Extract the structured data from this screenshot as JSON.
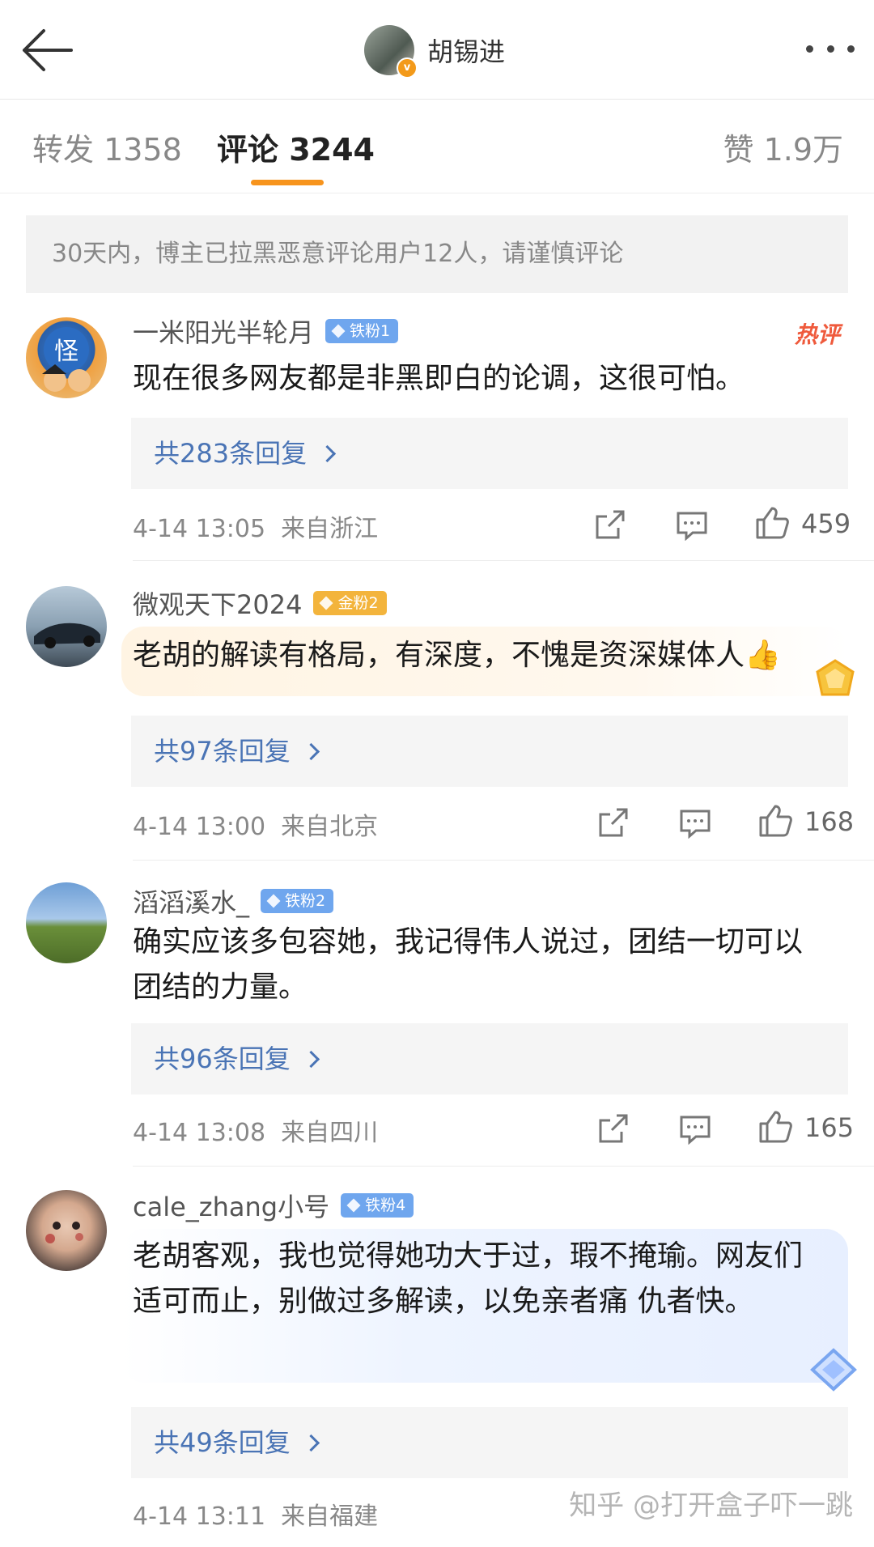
{
  "header": {
    "back_icon": "arrow-left-icon",
    "username": "胡锡进",
    "verified_icon": "verified-v-icon",
    "more_icon": "more-dots-icon"
  },
  "tabs": [
    {
      "label": "转发 1358"
    },
    {
      "label": "评论 3244"
    },
    {
      "label": "赞 1.9万"
    }
  ],
  "active_tab_color": "#f7941d",
  "notice": "30天内，博主已拉黑恶意评论用户12人，请谨慎评论",
  "comments": [
    {
      "name": "一米阳光半轮月",
      "badge": "铁粉1",
      "text": "现在很多网友都是非黑即白的论调，这很可怕。",
      "hot_tag": "热评",
      "replies": "共283条回复",
      "time": "4-14 13:05",
      "location": "来自浙江",
      "likes": "459"
    },
    {
      "name": "微观天下2024",
      "badge": "金粉2",
      "text": "老胡的解读有格局，有深度，不愧是资深媒体人👍",
      "replies": "共97条回复",
      "time": "4-14 13:00",
      "location": "来自北京",
      "likes": "168"
    },
    {
      "name": "滔滔溪水_",
      "badge": "铁粉2",
      "text": "确实应该多包容她，我记得伟人说过，团结一切可以团结的力量。",
      "replies": "共96条回复",
      "time": "4-14 13:08",
      "location": "来自四川",
      "likes": "165"
    },
    {
      "name": "cale_zhang小号",
      "badge": "铁粉4",
      "text": "老胡客观，我也觉得她功大于过，瑕不掩瑜。网友们适可而止，别做过多解读，以免亲者痛 仇者快。",
      "replies": "共49条回复",
      "time": "4-14 13:11",
      "location": "来自福建"
    }
  ],
  "watermark": "知乎 @打开盒子吓一跳",
  "colors": {
    "link": "#4a74b5",
    "iron_badge": "#6fa6ee",
    "gold_badge": "#f3b43c",
    "hot": "#ef5a3c"
  }
}
